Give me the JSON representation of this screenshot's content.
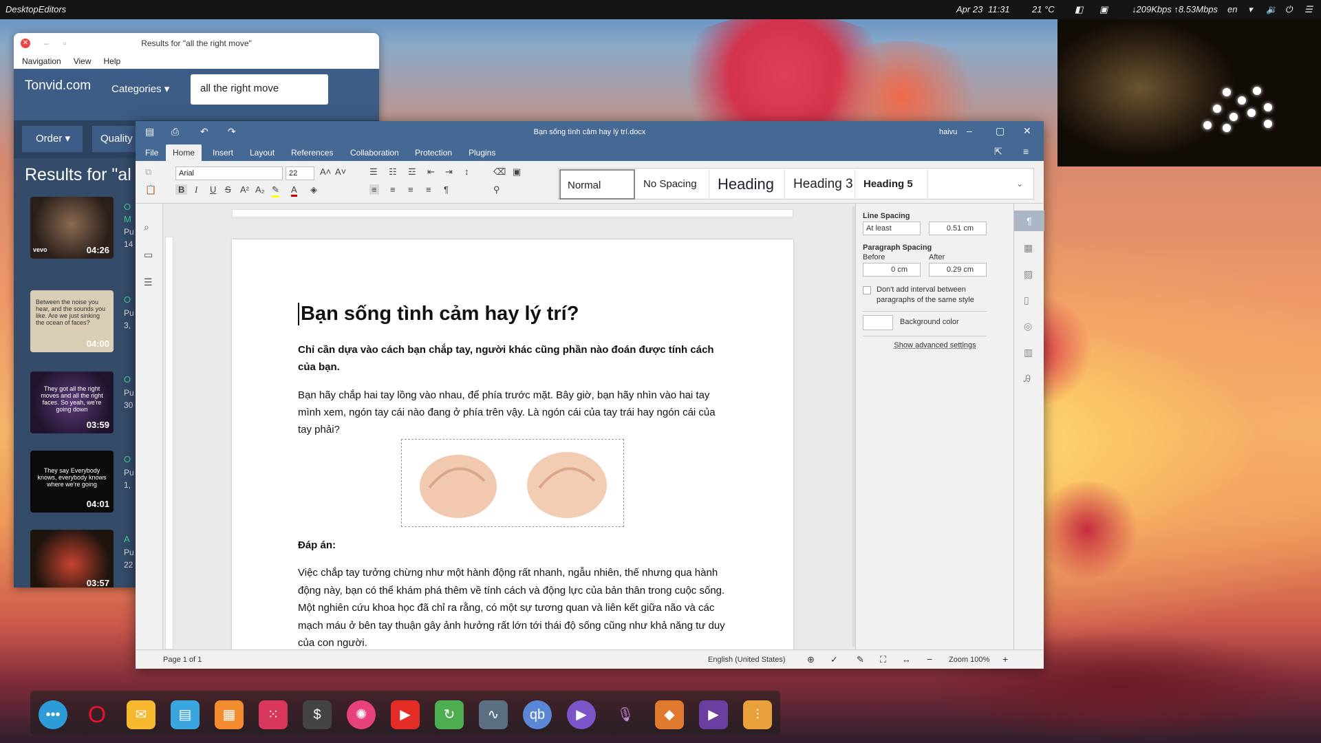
{
  "topbar": {
    "app": "DesktopEditors",
    "date": "Apr 23",
    "time": "11:31",
    "weather": "21 °C",
    "network": "↓209Kbps ↑8.53Mbps",
    "lang": "en"
  },
  "browser": {
    "title": "Results for \"all the right move\"",
    "menu": [
      "Navigation",
      "View",
      "Help"
    ],
    "logo": "Tonvid.com",
    "categories": "Categories ▾",
    "search_value": "all the right move",
    "order": "Order ▾",
    "quality": "Quality",
    "results_heading": "Results for \"al",
    "items": [
      {
        "duration": "04:26",
        "cap": "",
        "badge": "vevo",
        "t": "O",
        "m": "M",
        "p": "Pu",
        "n": "14"
      },
      {
        "duration": "04:00",
        "cap": "Between the noise you hear, and the sounds you like. Are we just sinking the ocean of faces?",
        "t": "O",
        "p": "Pu",
        "n": "3,"
      },
      {
        "duration": "03:59",
        "cap": "They got all the right moves and all the right faces. So yeah, we're going down",
        "t": "O",
        "p": "Pu",
        "n": "30"
      },
      {
        "duration": "04:01",
        "cap": "They say Everybody knows, everybody knows where we're going",
        "t": "O",
        "p": "Pu",
        "n": "1,"
      },
      {
        "duration": "03:57",
        "cap": "",
        "t": "A",
        "p": "Pu",
        "n": "22"
      }
    ]
  },
  "editor": {
    "title": "Bạn sống tình cảm hay lý trí.docx",
    "user": "haivu",
    "tabs": [
      "File",
      "Home",
      "Insert",
      "Layout",
      "References",
      "Collaboration",
      "Protection",
      "Plugins"
    ],
    "font": "Arial",
    "size": "22",
    "styles": [
      "Normal",
      "No Spacing",
      "Heading",
      "Heading 3",
      "Heading 5"
    ],
    "doc": {
      "title": "Bạn sống tình cảm hay lý trí?",
      "lead": "Chỉ cần dựa vào cách bạn chắp tay, người khác cũng phần nào đoán được tính cách của bạn.",
      "p1": "Bạn hãy chắp hai tay lồng vào nhau, để phía trước mặt. Bây giờ, bạn hãy nhìn vào hai tay mình xem, ngón tay cái nào đang ở phía trên vậy. Là ngón cái của tay trái hay ngón cái của tay phải?",
      "answer": "Đáp án:",
      "p2": "Việc chắp tay tưởng chừng như một hành động rất nhanh, ngẫu nhiên, thế nhưng qua hành động này, bạn có thể khám phá thêm về tính cách và động lực của bản thân trong cuộc sống. Một nghiên cứu khoa học đã chỉ ra rằng, có một sự tương quan và liên kết giữa não và các mạch máu ở bên tay thuận gây ảnh hưởng rất lớn tới thái độ sống cũng như khả năng tư duy của con người."
    },
    "panel": {
      "line_spacing": "Line Spacing",
      "ls_mode": "At least",
      "ls_value": "0.51 cm",
      "para_spacing": "Paragraph Spacing",
      "before": "Before",
      "after": "After",
      "before_val": "0 cm",
      "after_val": "0.29 cm",
      "no_interval": "Don't add interval between paragraphs of the same style",
      "bg_color": "Background color",
      "advanced": "Show advanced settings"
    },
    "status": {
      "page": "Page 1 of 1",
      "lang": "English (United States)",
      "zoom": "Zoom 100%"
    }
  }
}
